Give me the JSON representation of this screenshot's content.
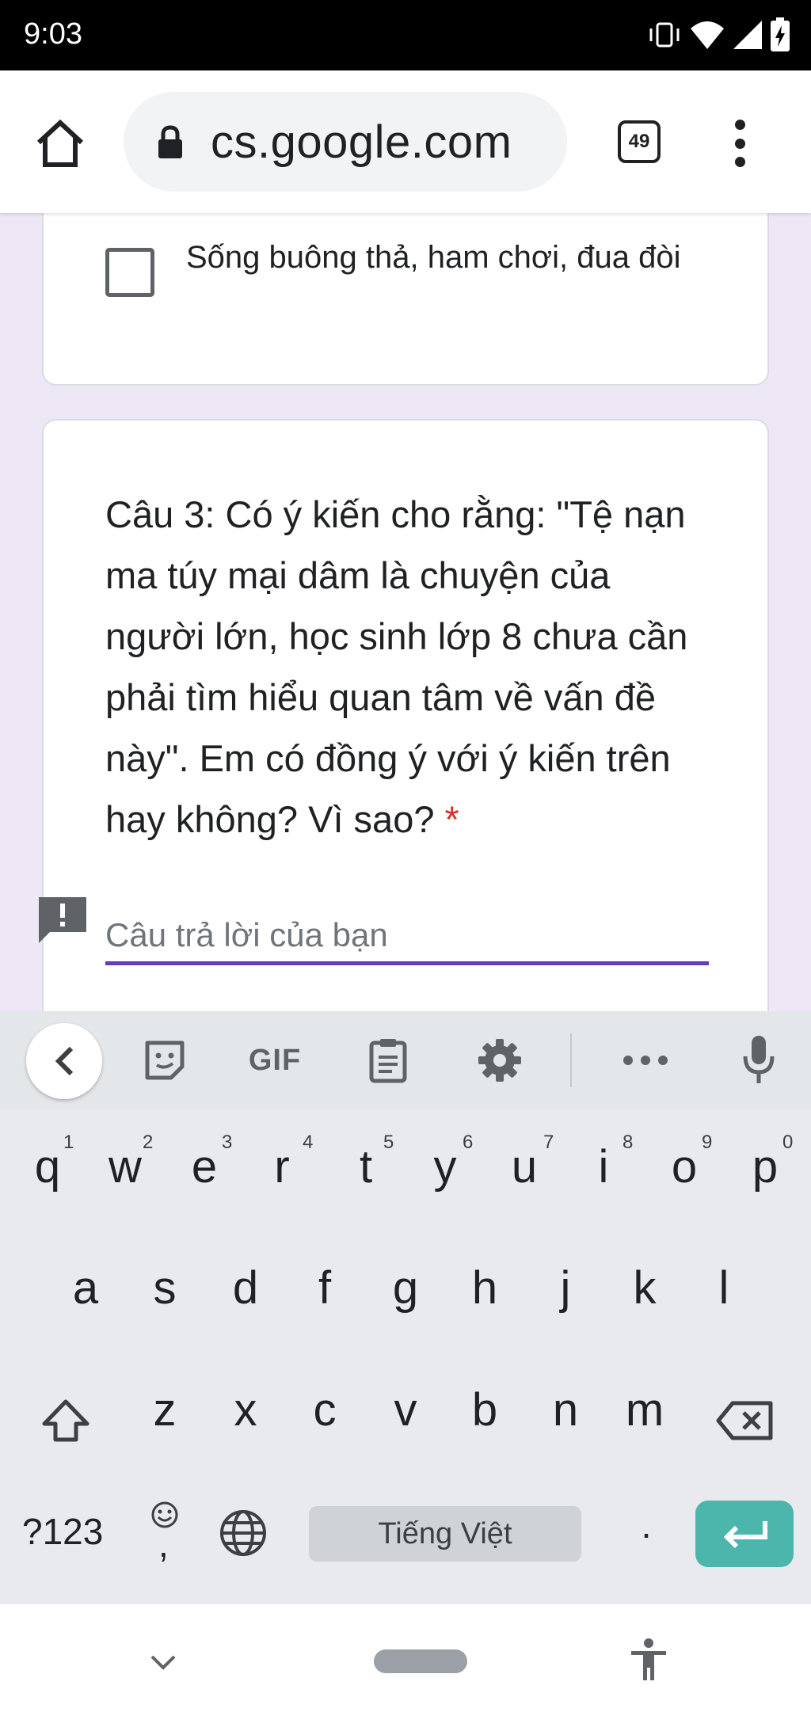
{
  "status_bar": {
    "time": "9:03"
  },
  "browser": {
    "url": "cs.google.com",
    "tab_count": "49"
  },
  "form": {
    "option_text": "Sống buông thả, ham chơi, đua đòi",
    "question_text": "Câu 3: Có ý kiến cho rằng: \"Tệ nạn ma túy mại dâm là chuyện của người lớn, học sinh lớp 8 chưa cần phải tìm hiểu quan tâm về vấn đề này\". Em có đồng ý với ý kiến trên hay không? Vì sao?",
    "required_mark": "*",
    "answer_placeholder": "Câu trả lời của bạn"
  },
  "keyboard": {
    "toolbar": {
      "gif": "GIF"
    },
    "row1": [
      "q",
      "w",
      "e",
      "r",
      "t",
      "y",
      "u",
      "i",
      "o",
      "p"
    ],
    "row1_hints": [
      "1",
      "2",
      "3",
      "4",
      "5",
      "6",
      "7",
      "8",
      "9",
      "0"
    ],
    "row2": [
      "a",
      "s",
      "d",
      "f",
      "g",
      "h",
      "j",
      "k",
      "l"
    ],
    "row3": [
      "z",
      "x",
      "c",
      "v",
      "b",
      "n",
      "m"
    ],
    "symbols_label": "?123",
    "comma": ",",
    "period": ".",
    "space_label": "Tiếng Việt"
  },
  "icons": [
    "home-icon",
    "lock-icon",
    "tab-switcher-icon",
    "more-vert-icon",
    "alert-icon",
    "back-arrow-icon",
    "sticker-icon",
    "clipboard-icon",
    "gear-icon",
    "more-horiz-icon",
    "mic-icon",
    "shift-icon",
    "backspace-icon",
    "emoji-icon",
    "globe-icon",
    "enter-icon",
    "nav-down-icon",
    "accessibility-icon"
  ],
  "colors": {
    "accent": "#673ab7",
    "required": "#d93025",
    "enter_key": "#4db6ac",
    "page_bg": "#ede7f6"
  }
}
